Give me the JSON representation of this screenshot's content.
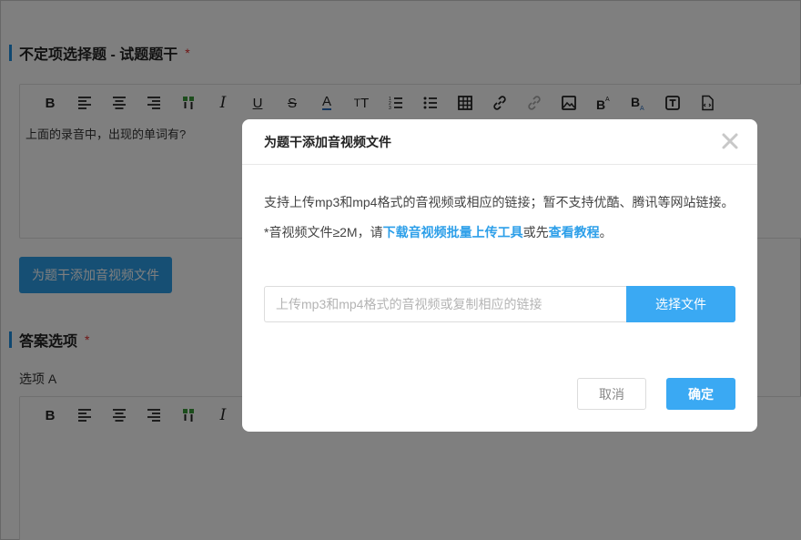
{
  "question_stem": {
    "title": "不定项选择题 - 试题题干",
    "required_mark": "*",
    "toolbar": [
      "B",
      "align-left-icon",
      "align-center-icon",
      "align-right-icon",
      "format-painter-icon",
      "I",
      "U",
      "S",
      "A",
      "TT",
      "ordered-list-icon",
      "unordered-list-icon",
      "table-icon",
      "link-icon",
      "unlink-icon",
      "image-icon",
      "superscript-icon",
      "subscript-icon",
      "textbox-icon",
      "code-file-icon"
    ],
    "content": "上面的录音中，出现的单词有?",
    "add_media_label": "为题干添加音视频文件"
  },
  "answer_options": {
    "title": "答案选项",
    "required_mark": "*",
    "option_a_label": "选项 A"
  },
  "modal": {
    "title": "为题干添加音视频文件",
    "desc1": "支持上传mp3和mp4格式的音视频或相应的链接；暂不支持优酷、腾讯等网站链接。",
    "desc2_prefix": "*音视频文件≥2M，请",
    "desc2_link1": "下载音视频批量上传工具",
    "desc2_mid": "或先",
    "desc2_link2": "查看教程",
    "desc2_suffix": "。",
    "input_placeholder": "上传mp3和mp4格式的音视频或复制相应的链接",
    "choose_file_label": "选择文件",
    "cancel_label": "取消",
    "confirm_label": "确定"
  },
  "colors": {
    "accent": "#2d9fe9",
    "overlay": "rgba(0,0,0,0.5)",
    "required": "#e02b2b"
  }
}
